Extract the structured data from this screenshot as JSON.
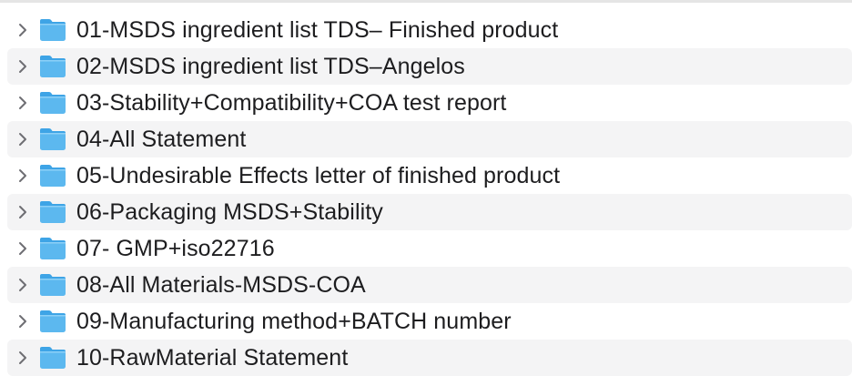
{
  "colors": {
    "folder_body": "#5cb8ef",
    "folder_tab": "#3ea4e6",
    "stripe": "#f4f4f5",
    "text": "#1d1d1f",
    "chevron": "#6e6e73"
  },
  "icons": {
    "disclosure": "chevron-right-icon",
    "folder": "folder-icon"
  },
  "files": [
    {
      "name": "01-MSDS ingredient list TDS– Finished product"
    },
    {
      "name": "02-MSDS ingredient list TDS–Angelos"
    },
    {
      "name": "03-Stability+Compatibility+COA test report"
    },
    {
      "name": "04-All Statement"
    },
    {
      "name": "05-Undesirable Effects letter of finished product"
    },
    {
      "name": "06-Packaging MSDS+Stability"
    },
    {
      "name": "07- GMP+iso22716"
    },
    {
      "name": "08-All Materials-MSDS-COA"
    },
    {
      "name": "09-Manufacturing method+BATCH number"
    },
    {
      "name": "10-RawMaterial Statement"
    }
  ]
}
